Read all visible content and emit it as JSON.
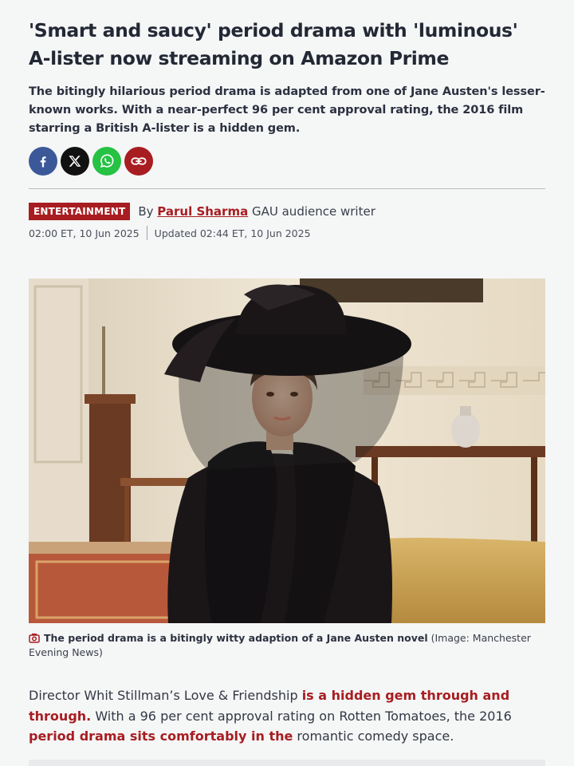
{
  "article": {
    "headline": "'Smart and saucy' period drama with 'luminous' A-lister now streaming on Amazon Prime",
    "standfirst": "The bitingly hilarious period drama is adapted from one of Jane Austen's lesser-known works. With a near-perfect 96 per cent approval rating, the 2016 film starring a British A-lister is a hidden gem.",
    "category": "ENTERTAINMENT",
    "by_prefix": "By",
    "author": "Parul Sharma",
    "author_role": "GAU audience writer",
    "published": "02:00 ET, 10 Jun 2025",
    "updated": "Updated 02:44 ET, 10 Jun 2025"
  },
  "share": {
    "icons": [
      "facebook-icon",
      "x-icon",
      "whatsapp-icon",
      "link-icon"
    ],
    "colors": {
      "facebook": "#3b5998",
      "x": "#111111",
      "whatsapp": "#25c243",
      "link": "#a71d21"
    }
  },
  "image": {
    "caption": "The period drama is a bitingly witty adaption of a Jane Austen novel",
    "credit": "(Image: Manchester Evening News)"
  },
  "body": {
    "p1_a": "Director Whit Stillman’s Love & Friendship ",
    "p1_link1": "is a hidden gem through and through.",
    "p1_b": " With a 96 per cent approval rating on Rotten Tomatoes, the 2016 ",
    "p1_link2": "period drama sits comfortably in the",
    "p1_c": " romantic comedy space."
  },
  "theme": {
    "accent": "#a71d21",
    "text": "#232835",
    "background": "#f5f6f6"
  }
}
